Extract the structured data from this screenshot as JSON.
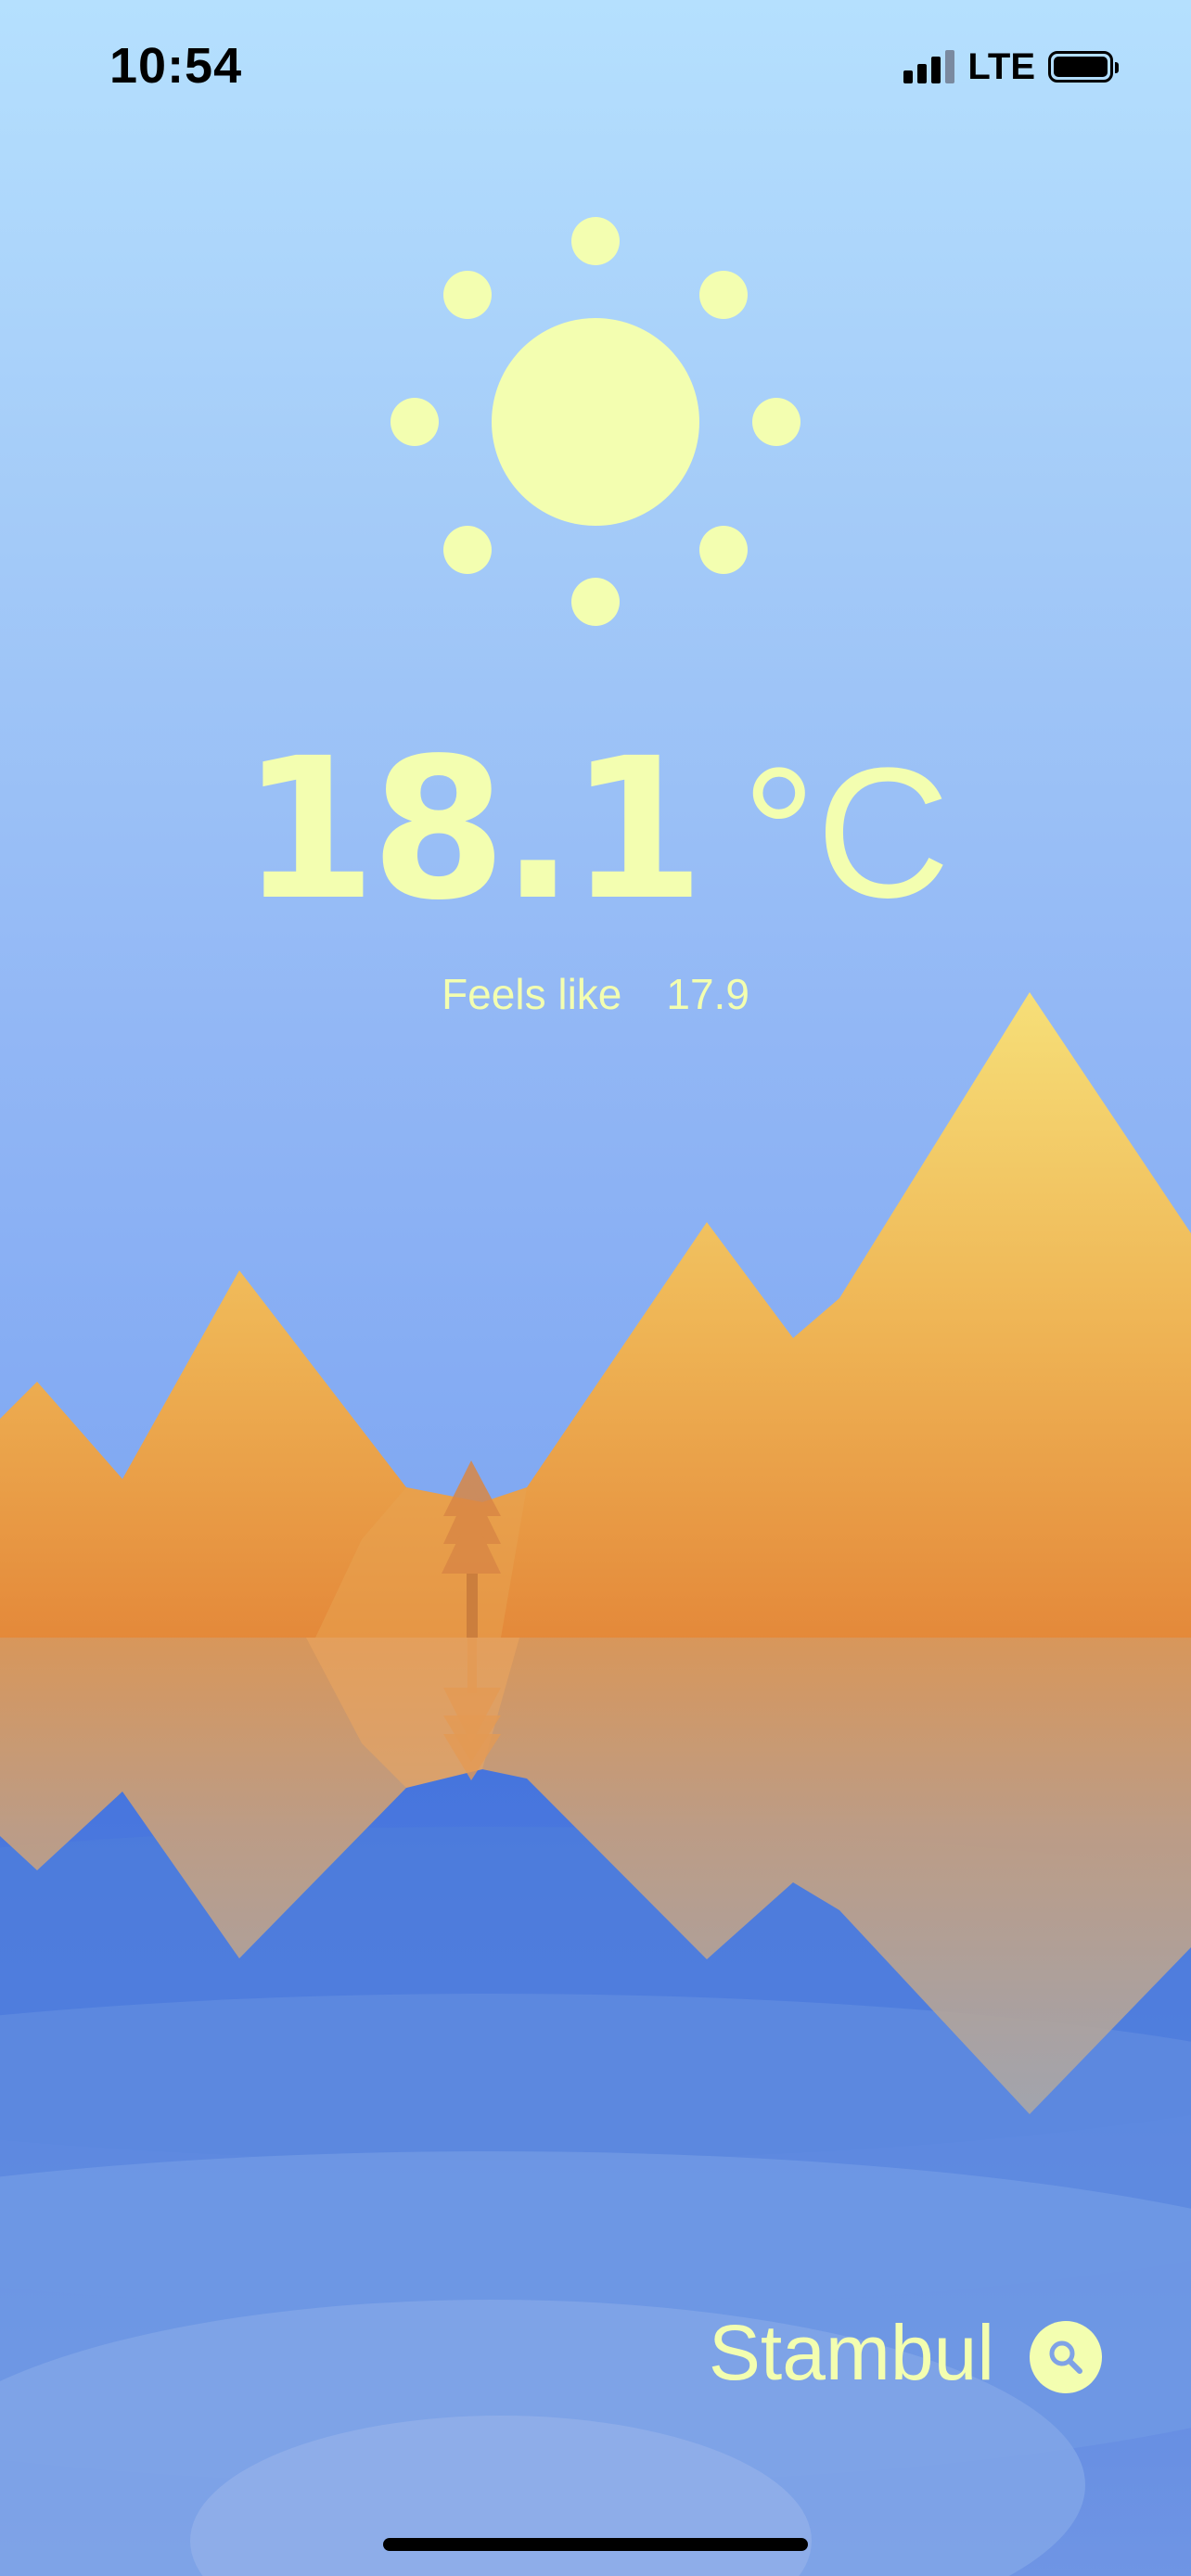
{
  "status_bar": {
    "time": "10:54",
    "network": "LTE",
    "icons": [
      "signal-icon",
      "battery-icon"
    ]
  },
  "weather": {
    "icon": "sun-icon",
    "temperature": "18.1",
    "unit": "°C",
    "feels_like_label": "Feels like",
    "feels_like_value": "17.9"
  },
  "location": {
    "city": "Stambul",
    "search_icon": "search-icon"
  },
  "colors": {
    "accent": "#f3feb0",
    "sky_top": "#b5e0fe",
    "mountain_top": "#f6dd7a",
    "mountain_bottom": "#e48a36",
    "water": "#4a7bdc"
  }
}
